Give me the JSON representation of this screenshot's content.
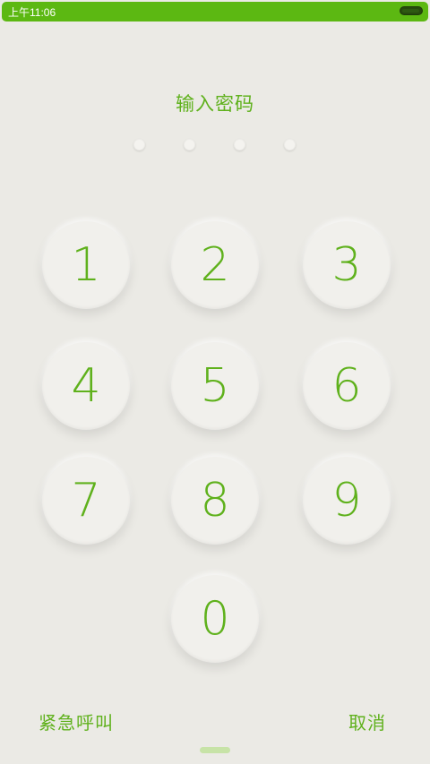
{
  "status_bar": {
    "time": "上午11:06",
    "battery_icon": "battery-icon"
  },
  "title": "输入密码",
  "pin": {
    "length": 4,
    "filled": 0
  },
  "keypad": {
    "keys": [
      "1",
      "2",
      "3",
      "4",
      "5",
      "6",
      "7",
      "8",
      "9",
      "0"
    ]
  },
  "actions": {
    "emergency_call": "紧急呼叫",
    "cancel": "取消"
  },
  "colors": {
    "accent": "#5fb11c",
    "status_bar": "#5cb812",
    "background": "#ebeae5",
    "key": "#f1f0ec"
  }
}
